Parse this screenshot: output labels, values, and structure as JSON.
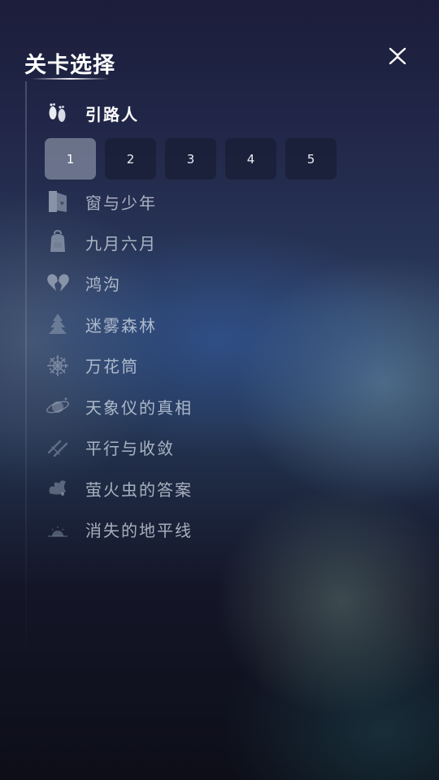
{
  "header": {
    "title": "关卡选择",
    "close_icon": "close-x-icon"
  },
  "levels": [
    {
      "label": "引路人",
      "icon": "footprints-icon",
      "active": true
    },
    {
      "label": "窗与少年",
      "icon": "door-icon"
    },
    {
      "label": "九月六月",
      "icon": "backpack-icon"
    },
    {
      "label": "鸿沟",
      "icon": "broken-heart-icon"
    },
    {
      "label": "迷雾森林",
      "icon": "tree-icon"
    },
    {
      "label": "万花筒",
      "icon": "kaleidoscope-icon"
    },
    {
      "label": "天象仪的真相",
      "icon": "planet-icon"
    },
    {
      "label": "平行与收敛",
      "icon": "parallel-lines-icon"
    },
    {
      "label": "萤火虫的答案",
      "icon": "firefly-icon"
    },
    {
      "label": "消失的地平线",
      "icon": "sunset-icon"
    }
  ],
  "stages": {
    "items": [
      "1",
      "2",
      "3",
      "4",
      "5"
    ],
    "selected": "1"
  },
  "colors": {
    "background_top": "#1b1d3a",
    "background_bottom": "#0d0e18",
    "stage_selected": "#969fb2",
    "stage_default": "#161c30"
  }
}
